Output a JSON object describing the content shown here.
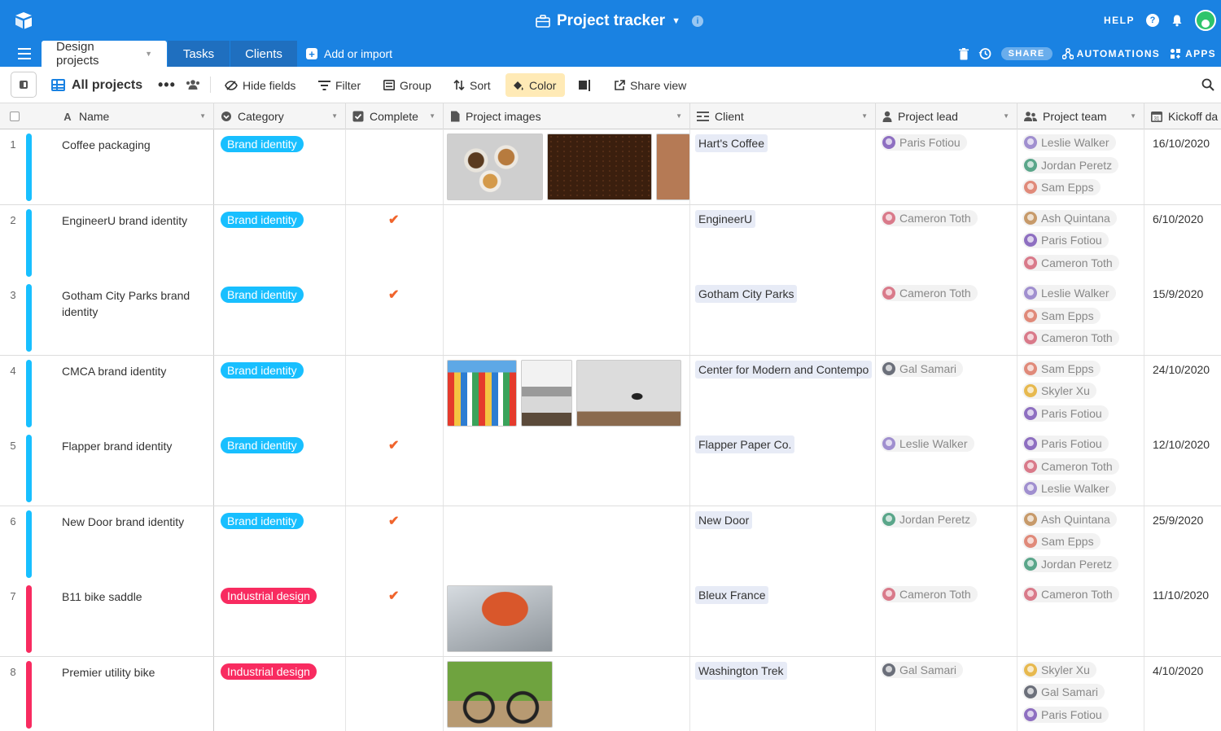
{
  "app": {
    "title": "Project tracker",
    "help_label": "HELP",
    "share_label": "SHARE",
    "automations_label": "AUTOMATIONS",
    "apps_label": "APPS"
  },
  "tabs": [
    {
      "label": "Design projects",
      "active": true
    },
    {
      "label": "Tasks",
      "active": false
    },
    {
      "label": "Clients",
      "active": false
    }
  ],
  "add_import_label": "Add or import",
  "toolbar": {
    "view_name": "All projects",
    "more_label": "•••",
    "hide_fields": "Hide fields",
    "filter": "Filter",
    "group": "Group",
    "sort": "Sort",
    "color": "Color",
    "share_view": "Share view"
  },
  "columns": {
    "name": "Name",
    "category": "Category",
    "complete": "Complete",
    "images": "Project images",
    "client": "Client",
    "lead": "Project lead",
    "team": "Project team",
    "kickoff": "Kickoff da"
  },
  "colors": {
    "brand": "#1a82e2",
    "brand_identity": "#18bfff",
    "industrial_design": "#f82b60",
    "check": "#f0642c"
  },
  "rows": [
    {
      "num": "1",
      "name": "Coffee packaging",
      "category": "Brand identity",
      "cat_color": "#18bfff",
      "complete": false,
      "client": "Hart's Coffee",
      "lead": "Paris Fotiou",
      "team": [
        "Leslie Walker",
        "Jordan Peretz",
        "Sam Epps"
      ],
      "kickoff": "16/10/2020"
    },
    {
      "num": "2",
      "name": "EngineerU brand identity",
      "category": "Brand identity",
      "cat_color": "#18bfff",
      "complete": true,
      "client": "EngineerU",
      "lead": "Cameron Toth",
      "team": [
        "Ash Quintana",
        "Paris Fotiou",
        "Cameron Toth"
      ],
      "kickoff": "6/10/2020"
    },
    {
      "num": "3",
      "name": "Gotham City Parks brand identity",
      "category": "Brand identity",
      "cat_color": "#18bfff",
      "complete": true,
      "client": "Gotham City Parks",
      "lead": "Cameron Toth",
      "team": [
        "Leslie Walker",
        "Sam Epps",
        "Cameron Toth"
      ],
      "kickoff": "15/9/2020"
    },
    {
      "num": "4",
      "name": "CMCA brand identity",
      "category": "Brand identity",
      "cat_color": "#18bfff",
      "complete": false,
      "client": "Center for Modern and Contempo",
      "lead": "Gal Samari",
      "team": [
        "Sam Epps",
        "Skyler Xu",
        "Paris Fotiou"
      ],
      "kickoff": "24/10/2020"
    },
    {
      "num": "5",
      "name": "Flapper brand identity",
      "category": "Brand identity",
      "cat_color": "#18bfff",
      "complete": true,
      "client": "Flapper Paper Co.",
      "lead": "Leslie Walker",
      "team": [
        "Paris Fotiou",
        "Cameron Toth",
        "Leslie Walker"
      ],
      "kickoff": "12/10/2020"
    },
    {
      "num": "6",
      "name": "New Door brand identity",
      "category": "Brand identity",
      "cat_color": "#18bfff",
      "complete": true,
      "client": "New Door",
      "lead": "Jordan Peretz",
      "team": [
        "Ash Quintana",
        "Sam Epps",
        "Jordan Peretz"
      ],
      "kickoff": "25/9/2020"
    },
    {
      "num": "7",
      "name": "B11 bike saddle",
      "category": "Industrial design",
      "cat_color": "#f82b60",
      "complete": true,
      "client": "Bleux France",
      "lead": "Cameron Toth",
      "team": [
        "Cameron Toth"
      ],
      "kickoff": "11/10/2020"
    },
    {
      "num": "8",
      "name": "Premier utility bike",
      "category": "Industrial design",
      "cat_color": "#f82b60",
      "complete": false,
      "client": "Washington Trek",
      "lead": "Gal Samari",
      "team": [
        "Skyler Xu",
        "Gal Samari",
        "Paris Fotiou"
      ],
      "kickoff": "4/10/2020"
    }
  ]
}
